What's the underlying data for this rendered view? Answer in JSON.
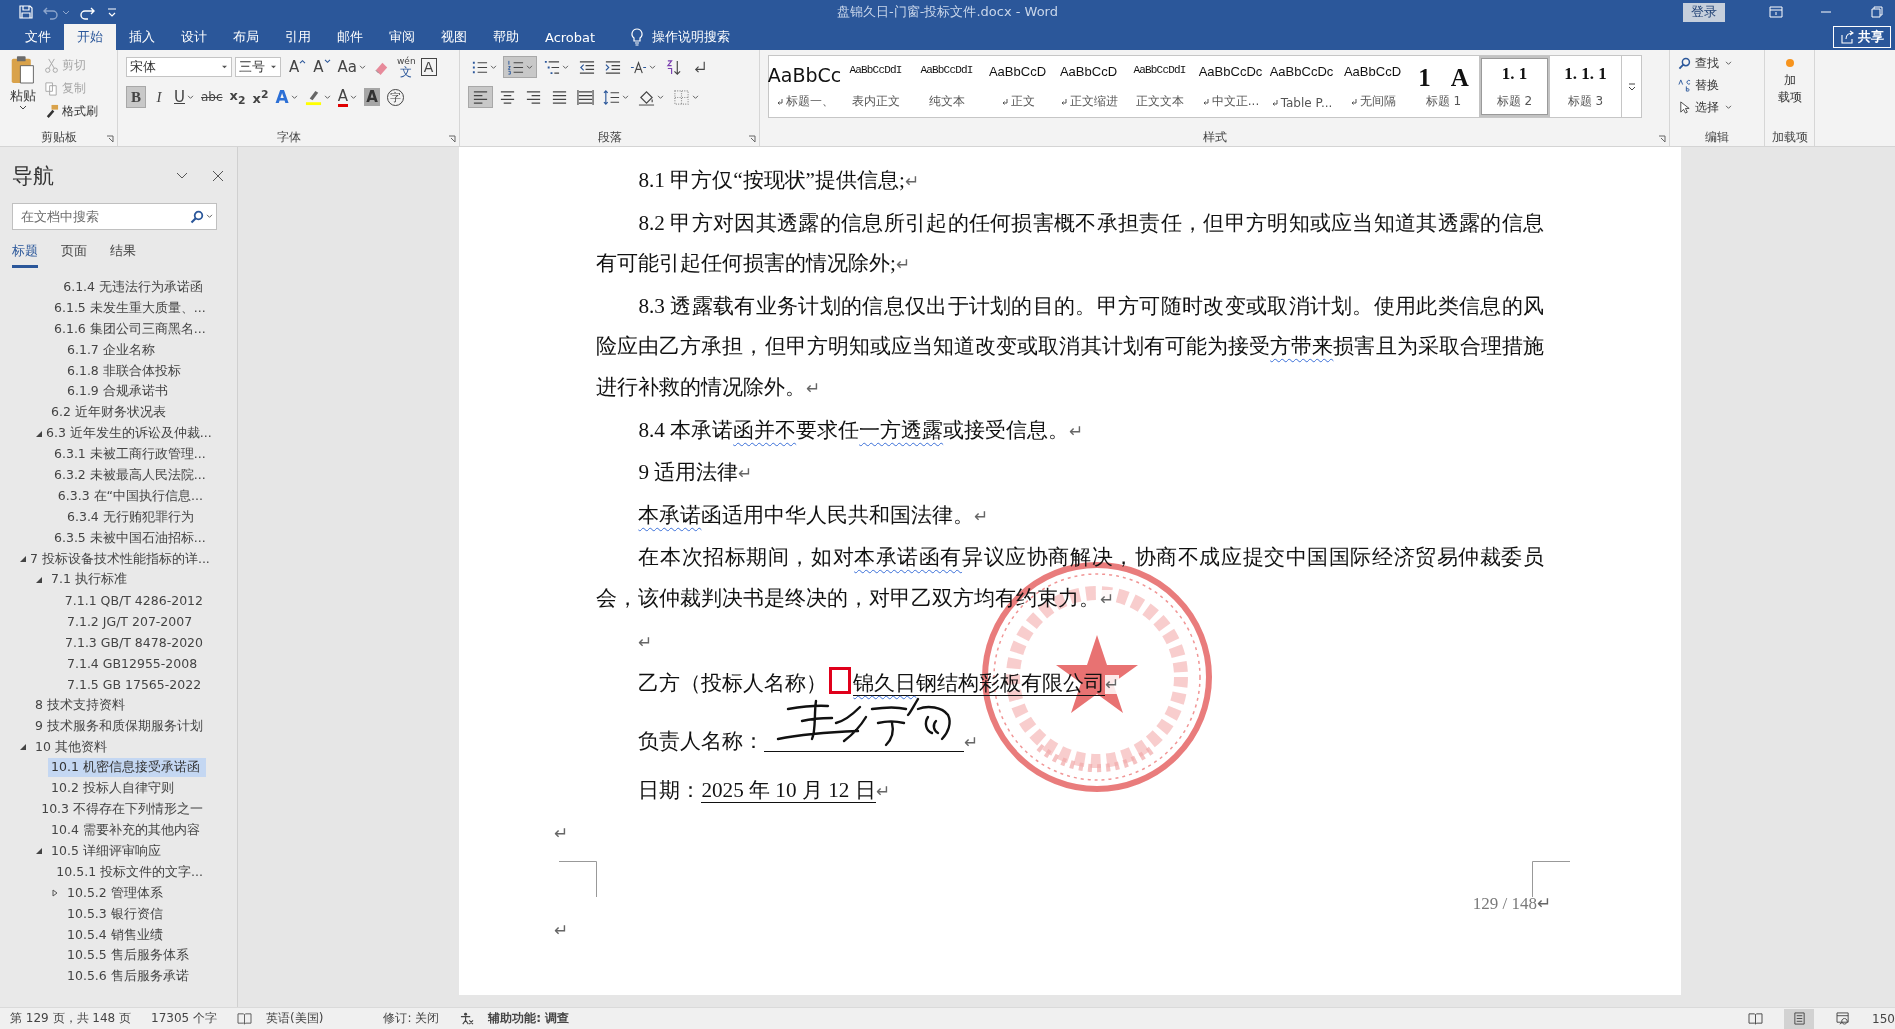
{
  "window": {
    "title": "盘锦久日-门窗-投标文件.docx - Word",
    "sign_in": "登录",
    "share": "共享"
  },
  "ribbon_tabs": [
    {
      "label": "文件",
      "selected": false
    },
    {
      "label": "开始",
      "selected": true
    },
    {
      "label": "插入",
      "selected": false
    },
    {
      "label": "设计",
      "selected": false
    },
    {
      "label": "布局",
      "selected": false
    },
    {
      "label": "引用",
      "selected": false
    },
    {
      "label": "邮件",
      "selected": false
    },
    {
      "label": "审阅",
      "selected": false
    },
    {
      "label": "视图",
      "selected": false
    },
    {
      "label": "帮助",
      "selected": false
    },
    {
      "label": "Acrobat",
      "selected": false
    }
  ],
  "tell_me": "操作说明搜索",
  "clipboard": {
    "group": "剪贴板",
    "paste": "粘贴",
    "items": [
      {
        "kind": "cut",
        "label": "剪切",
        "disabled": true
      },
      {
        "kind": "copy",
        "label": "复制",
        "disabled": true
      },
      {
        "kind": "painter",
        "label": "格式刷",
        "disabled": false
      }
    ]
  },
  "font": {
    "group": "字体",
    "name": "宋体",
    "size": "三号",
    "row1": [
      {
        "kind": "grow",
        "label": "A"
      },
      {
        "kind": "shrink",
        "label": "A"
      },
      {
        "kind": "case",
        "label": "Aa"
      },
      {
        "kind": "clear"
      },
      {
        "kind": "phonetic",
        "label": "wén",
        "sub": "文"
      },
      {
        "kind": "border",
        "label": "A"
      }
    ],
    "row2": [
      {
        "kind": "bold",
        "label": "B",
        "pressed": true
      },
      {
        "kind": "italic",
        "label": "I",
        "pressed": false
      },
      {
        "kind": "underline",
        "label": "U",
        "pressed": false
      },
      {
        "kind": "strike",
        "label": "abc",
        "pressed": false
      },
      {
        "kind": "subscript",
        "label": "x$_{2}$",
        "pressed": false
      },
      {
        "kind": "superscript",
        "label": "x$^{2}$",
        "pressed": false
      },
      {
        "kind": "effects",
        "label": "A",
        "pressed": false
      },
      {
        "kind": "highlight",
        "pressed": false
      },
      {
        "kind": "color",
        "label": "A",
        "pressed": false
      },
      {
        "kind": "shading",
        "label": "A",
        "pressed": false
      },
      {
        "kind": "enclose",
        "label": "字",
        "pressed": false
      }
    ]
  },
  "paragraph": {
    "group": "段落",
    "row1": [
      {
        "kind": "bullets",
        "pressed": false
      },
      {
        "kind": "numbering",
        "pressed": true
      },
      {
        "kind": "multilevel",
        "pressed": false
      },
      {
        "kind": "outdent",
        "pressed": false
      },
      {
        "kind": "indent",
        "pressed": false
      },
      {
        "kind": "asian",
        "pressed": false
      },
      {
        "kind": "sort",
        "pressed": false
      },
      {
        "kind": "marks",
        "pressed": false
      }
    ],
    "row2": [
      {
        "kind": "align-left",
        "pressed": true
      },
      {
        "kind": "center",
        "pressed": false
      },
      {
        "kind": "align-right",
        "pressed": false
      },
      {
        "kind": "justify",
        "pressed": false
      },
      {
        "kind": "distribute",
        "pressed": false
      },
      {
        "kind": "line-spacing",
        "pressed": false
      },
      {
        "kind": "fill",
        "pressed": false
      },
      {
        "kind": "borders",
        "pressed": false
      }
    ]
  },
  "styles": {
    "group": "样式",
    "items": [
      {
        "kind": "title",
        "previews": [
          "AaBbCc"
        ],
        "name": "标题一、",
        "linked": true,
        "selected": false
      },
      {
        "kind": "compact",
        "previews": [
          "AaBbCcDdI"
        ],
        "name": "表内正文",
        "linked": false,
        "selected": false
      },
      {
        "kind": "compact",
        "previews": [
          "AaBbCcDdI"
        ],
        "name": "纯文本",
        "linked": false,
        "selected": false
      },
      {
        "kind": "normal",
        "previews": [
          "AaBbCcD"
        ],
        "name": "正文",
        "linked": true,
        "selected": false
      },
      {
        "kind": "normal",
        "previews": [
          "AaBbCcD"
        ],
        "name": "正文缩进",
        "linked": true,
        "selected": false
      },
      {
        "kind": "compact",
        "previews": [
          "AaBbCcDdI"
        ],
        "name": "正文文本",
        "linked": false,
        "selected": false
      },
      {
        "kind": "normal",
        "previews": [
          "AaBbCcDc"
        ],
        "name": "中文正...",
        "linked": true,
        "selected": false
      },
      {
        "kind": "normal",
        "previews": [
          "AaBbCcDc"
        ],
        "name": "Table P...",
        "linked": true,
        "selected": false
      },
      {
        "kind": "normal",
        "previews": [
          "AaBbCcD"
        ],
        "name": "无间隔",
        "linked": true,
        "selected": false
      },
      {
        "kind": "heading1",
        "previews": [
          "1",
          "A"
        ],
        "name": "标题 1",
        "linked": false,
        "selected": false
      },
      {
        "kind": "heading",
        "previews": [
          "1. 1"
        ],
        "name": "标题 2",
        "linked": false,
        "selected": true
      },
      {
        "kind": "heading",
        "previews": [
          "1. 1. 1"
        ],
        "name": "标题 3",
        "linked": false,
        "selected": false
      }
    ]
  },
  "editing": {
    "group": "编辑",
    "items": [
      {
        "kind": "find",
        "label": "查找"
      },
      {
        "kind": "replace",
        "label": "替换"
      },
      {
        "kind": "select",
        "label": "选择"
      }
    ]
  },
  "addins": {
    "group": "加载项",
    "button": [
      "加",
      "载项"
    ]
  },
  "navigation": {
    "title": "导航",
    "search_placeholder": "在文档中搜索",
    "tabs": [
      {
        "label": "标题",
        "selected": true
      },
      {
        "label": "页面",
        "selected": false
      },
      {
        "label": "结果",
        "selected": false
      }
    ],
    "headings": [
      {
        "children": [
          {
            "children": [
              {
                "label": "6.1.4 无违法行为承诺函",
                "selected": false
              },
              {
                "label": "6.1.5 未发生重大质量、...",
                "selected": false
              },
              {
                "label": "6.1.6 集团公司三商黑名...",
                "selected": false
              },
              {
                "label": "6.1.7 企业名称",
                "selected": false
              },
              {
                "label": "6.1.8 非联合体投标",
                "selected": false
              },
              {
                "label": "6.1.9 合规承诺书",
                "selected": false
              }
            ]
          },
          {
            "label": "6.2 近年财务状况表",
            "selected": false
          },
          {
            "label": "6.3 近年发生的诉讼及仲裁...",
            "selected": false,
            "expanded": true,
            "children": [
              {
                "label": "6.3.1 未被工商行政管理...",
                "selected": false
              },
              {
                "label": "6.3.2 未被最高人民法院...",
                "selected": false
              },
              {
                "label": "6.3.3 在“中国执行信息...",
                "selected": false
              },
              {
                "label": "6.3.4 无行贿犯罪行为",
                "selected": false
              },
              {
                "label": "6.3.5 未被中国石油招标...",
                "selected": false
              }
            ]
          }
        ]
      },
      {
        "label": "7 投标设备技术性能指标的详...",
        "selected": false,
        "expanded": true,
        "children": [
          {
            "label": "7.1 执行标准",
            "selected": false,
            "expanded": true,
            "children": [
              {
                "label": "7.1.1 QB/T 4286-2012",
                "selected": false
              },
              {
                "label": "7.1.2 JG/T 207-2007",
                "selected": false
              },
              {
                "label": "7.1.3 GB/T 8478-2020",
                "selected": false
              },
              {
                "label": "7.1.4 GB12955-2008",
                "selected": false
              },
              {
                "label": "7.1.5 GB 17565-2022",
                "selected": false
              }
            ]
          }
        ]
      },
      {
        "label": "8 技术支持资料",
        "selected": false
      },
      {
        "label": "9 技术服务和质保期服务计划",
        "selected": false
      },
      {
        "label": "10 其他资料",
        "selected": false,
        "expanded": true,
        "children": [
          {
            "label": "10.1 机密信息接受承诺函",
            "selected": true
          },
          {
            "label": "10.2 投标人自律守则",
            "selected": false
          },
          {
            "label": "10.3 不得存在下列情形之一",
            "selected": false
          },
          {
            "label": "10.4 需要补充的其他内容",
            "selected": false
          },
          {
            "label": "10.5 详细评审响应",
            "selected": false,
            "expanded": true,
            "children": [
              {
                "label": "10.5.1 投标文件的文字...",
                "selected": false
              },
              {
                "label": "10.5.2 管理体系",
                "selected": false,
                "expanded": false
              },
              {
                "label": "10.5.3 银行资信",
                "selected": false
              },
              {
                "label": "10.5.4 销售业绩",
                "selected": false
              },
              {
                "label": "10.5.5 售后服务体系",
                "selected": false
              },
              {
                "label": "10.5.6 售后服务承诺",
                "selected": false
              }
            ]
          }
        ]
      }
    ]
  },
  "document": {
    "paragraphs": [
      {
        "kind": "body",
        "segments": [
          {
            "kind": "text",
            "text": "8.1 甲方仅“按现状”提供信息;",
            "wavy": false,
            "underline": false
          }
        ],
        "mark": "↵"
      },
      {
        "kind": "body",
        "segments": [
          {
            "kind": "text",
            "text": "8.2 甲方对因其透露的信息所引起的任何损害概不承担责任，但甲方明知或应当知道其透露的信息有可能引起任何损害的情况除外;",
            "wavy": false,
            "underline": false
          }
        ],
        "mark": "↵"
      },
      {
        "kind": "body",
        "segments": [
          {
            "kind": "text",
            "text": "8.3 透露载有业务计划的信息仅出于计划的目的。甲方可随时改变或取消计划。使用此类信息的风险应由乙方承担，但甲方明知或应当知道改变或取消其计划有可能为接受",
            "wavy": false,
            "underline": false
          },
          {
            "kind": "text",
            "text": "方带来",
            "wavy": true,
            "underline": false
          },
          {
            "kind": "text",
            "text": "损害且为采取合理措施进行补救的情况除外。",
            "wavy": false,
            "underline": false
          }
        ],
        "mark": "↵"
      },
      {
        "kind": "body",
        "segments": [
          {
            "kind": "text",
            "text": "8.4 本承诺",
            "wavy": false,
            "underline": false
          },
          {
            "kind": "text",
            "text": "函并不",
            "wavy": true,
            "underline": false
          },
          {
            "kind": "text",
            "text": "要求任",
            "wavy": false,
            "underline": false
          },
          {
            "kind": "text",
            "text": "一方透露",
            "wavy": true,
            "underline": false
          },
          {
            "kind": "text",
            "text": "或接受信息。",
            "wavy": false,
            "underline": false
          }
        ],
        "mark": "↵"
      },
      {
        "kind": "body",
        "segments": [
          {
            "kind": "text",
            "text": "9 适用法律",
            "wavy": false,
            "underline": false
          }
        ],
        "mark": "↵"
      },
      {
        "kind": "body",
        "segments": [
          {
            "kind": "text",
            "text": "本承诺",
            "wavy": true,
            "underline": false
          },
          {
            "kind": "text",
            "text": "函适用中华人民共和国法律。",
            "wavy": false,
            "underline": false
          }
        ],
        "mark": "↵"
      },
      {
        "kind": "body",
        "segments": [
          {
            "kind": "text",
            "text": "在本次招标期间，如对",
            "wavy": false,
            "underline": false
          },
          {
            "kind": "text",
            "text": "本承诺函有",
            "wavy": true,
            "underline": false
          },
          {
            "kind": "text",
            "text": "异议应协商解决，协商不成应提交中国国际经济贸易仲裁委员会，该仲裁判决书是终决的，对甲乙双方均有约束力。",
            "wavy": false,
            "underline": false
          }
        ],
        "mark": "↵"
      },
      {
        "kind": "body",
        "mark": "↵"
      },
      {
        "kind": "body",
        "segments": [
          {
            "kind": "text",
            "text": "乙方（投标人名称）",
            "wavy": false,
            "underline": false
          },
          {
            "kind": "box"
          },
          {
            "kind": "text",
            "text": "锦久日",
            "wavy": true,
            "underline": true
          },
          {
            "kind": "text",
            "text": "钢结构彩板有限公司",
            "wavy": false,
            "underline": true
          }
        ],
        "mark": "↵"
      },
      {
        "kind": "body",
        "segments": [
          {
            "kind": "text",
            "text": "负责人名称：",
            "wavy": false,
            "underline": false
          },
          {
            "kind": "blank"
          }
        ],
        "mark": "↵"
      },
      {
        "kind": "body",
        "segments": [
          {
            "kind": "text",
            "text": "日期：",
            "wavy": false,
            "underline": false
          },
          {
            "kind": "text",
            "text": "2025 年 10 月 12 日",
            "wavy": false,
            "underline": true
          }
        ],
        "mark": "↵"
      },
      {
        "kind": "flush",
        "mark": "↵"
      }
    ],
    "footer": {
      "page_number": "129 / 148",
      "mark": "↵"
    },
    "end_mark": "↵"
  },
  "status_bar": {
    "page": "第 129 页，共 148 页",
    "words": "17305 个字",
    "language": "英语(美国)",
    "track_changes": "修订: 关闭",
    "accessibility": "辅助功能: 调查",
    "views": [
      {
        "kind": "read",
        "selected": false
      },
      {
        "kind": "print",
        "selected": true
      },
      {
        "kind": "web",
        "selected": false
      }
    ],
    "zoom": "150"
  }
}
